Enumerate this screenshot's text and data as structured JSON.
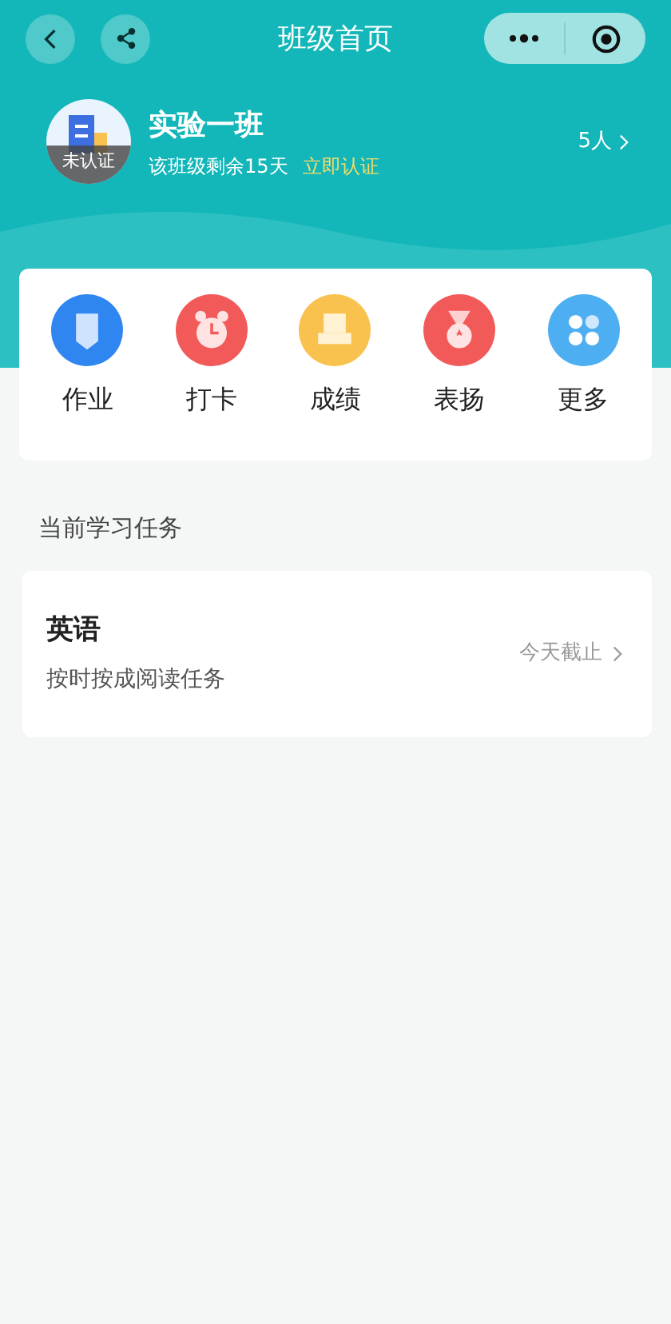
{
  "nav": {
    "title": "班级首页"
  },
  "class_info": {
    "avatar_badge": "未认证",
    "name": "实验一班",
    "remaining": "该班级剩余15天",
    "verify_link": "立即认证",
    "members": "5人"
  },
  "menu": [
    {
      "kind": "homework",
      "label": "作业",
      "color": "#2f86f0"
    },
    {
      "kind": "alarm",
      "label": "打卡",
      "color": "#f25a5a"
    },
    {
      "kind": "score",
      "label": "成绩",
      "color": "#f9c24f"
    },
    {
      "kind": "medal",
      "label": "表扬",
      "color": "#f25a5a"
    },
    {
      "kind": "more",
      "label": "更多",
      "color": "#4eaef2"
    }
  ],
  "section_title": "当前学习任务",
  "tasks": [
    {
      "subject": "英语",
      "description": "按时按成阅读任务",
      "deadline": "今天截止"
    }
  ]
}
